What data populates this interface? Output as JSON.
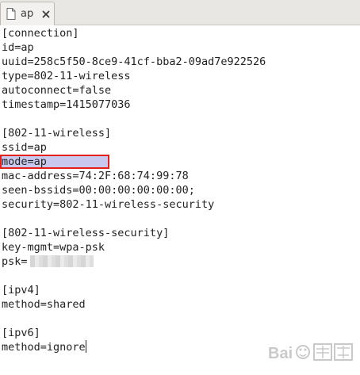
{
  "tab": {
    "title": "ap",
    "doc_icon": "document-icon",
    "close_icon": "close-icon"
  },
  "editor": {
    "lines": [
      "[connection]",
      "id=ap",
      "uuid=258c5f50-8ce9-41cf-bba2-09ad7e922526",
      "type=802-11-wireless",
      "autoconnect=false",
      "timestamp=1415077036",
      "",
      "[802-11-wireless]",
      "ssid=ap",
      "mode=ap",
      "mac-address=74:2F:68:74:99:78",
      "seen-bssids=00:00:00:00:00:00;",
      "security=802-11-wireless-security",
      "",
      "[802-11-wireless-security]",
      "key-mgmt=wpa-psk",
      "psk=",
      "",
      "[ipv4]",
      "method=shared",
      "",
      "[ipv6]",
      "method=ignore"
    ],
    "highlighted_line_index": 9,
    "highlight_color": "#c9c9f0",
    "highlight_border_color": "#e3201b"
  }
}
